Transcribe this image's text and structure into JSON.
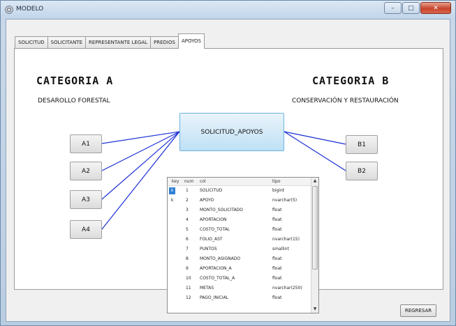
{
  "window": {
    "title": "MODELO",
    "minimize_glyph": "–",
    "maximize_glyph": "□",
    "close_glyph": "✕"
  },
  "tabs": [
    {
      "label": "SOLICITUD",
      "active": false
    },
    {
      "label": "SOLICITANTE",
      "active": false
    },
    {
      "label": "REPRESENTANTE LEGAL",
      "active": false
    },
    {
      "label": "PREDIOS",
      "active": false
    },
    {
      "label": "APOYOS",
      "active": true
    }
  ],
  "category_a": {
    "title": "CATEGORIA A",
    "subtitle": "DESAROLLO FORESTAL",
    "items": [
      "A1",
      "A2",
      "A3",
      "A4"
    ]
  },
  "category_b": {
    "title": "CATEGORIA B",
    "subtitle": "CONSERVACIÓN Y RESTAURACIÓN",
    "items": [
      "B1",
      "B2"
    ]
  },
  "center_table": {
    "label": "SOLICITUD_APOYOS"
  },
  "connector_color": "#1a2fd6",
  "grid": {
    "headers": {
      "key": "key",
      "num": "num",
      "col": "col",
      "tipo": "tipo"
    },
    "rows": [
      {
        "key": "k",
        "num": "1",
        "col": "SOLICITUD",
        "tipo": "bigint",
        "selected": true
      },
      {
        "key": "k",
        "num": "2",
        "col": "APOYO",
        "tipo": "nvarchar(5)"
      },
      {
        "key": "",
        "num": "3",
        "col": "MONTO_SOLICITADO",
        "tipo": "float"
      },
      {
        "key": "",
        "num": "4",
        "col": "APORTACION",
        "tipo": "float"
      },
      {
        "key": "",
        "num": "5",
        "col": "COSTO_TOTAL",
        "tipo": "float"
      },
      {
        "key": "",
        "num": "6",
        "col": "FOLIO_AST",
        "tipo": "nvarchar(15)"
      },
      {
        "key": "",
        "num": "7",
        "col": "PUNTOS",
        "tipo": "smallint"
      },
      {
        "key": "",
        "num": "8",
        "col": "MONTO_ASIGNADO",
        "tipo": "float"
      },
      {
        "key": "",
        "num": "9",
        "col": "APORTACION_A",
        "tipo": "float"
      },
      {
        "key": "",
        "num": "10",
        "col": "COSTO_TOTAL_A",
        "tipo": "float"
      },
      {
        "key": "",
        "num": "11",
        "col": "METAS",
        "tipo": "nvarchar(250)"
      },
      {
        "key": "",
        "num": "12",
        "col": "PAGO_INICIAL",
        "tipo": "float"
      }
    ]
  },
  "footer": {
    "back_button": "REGRESAR"
  }
}
